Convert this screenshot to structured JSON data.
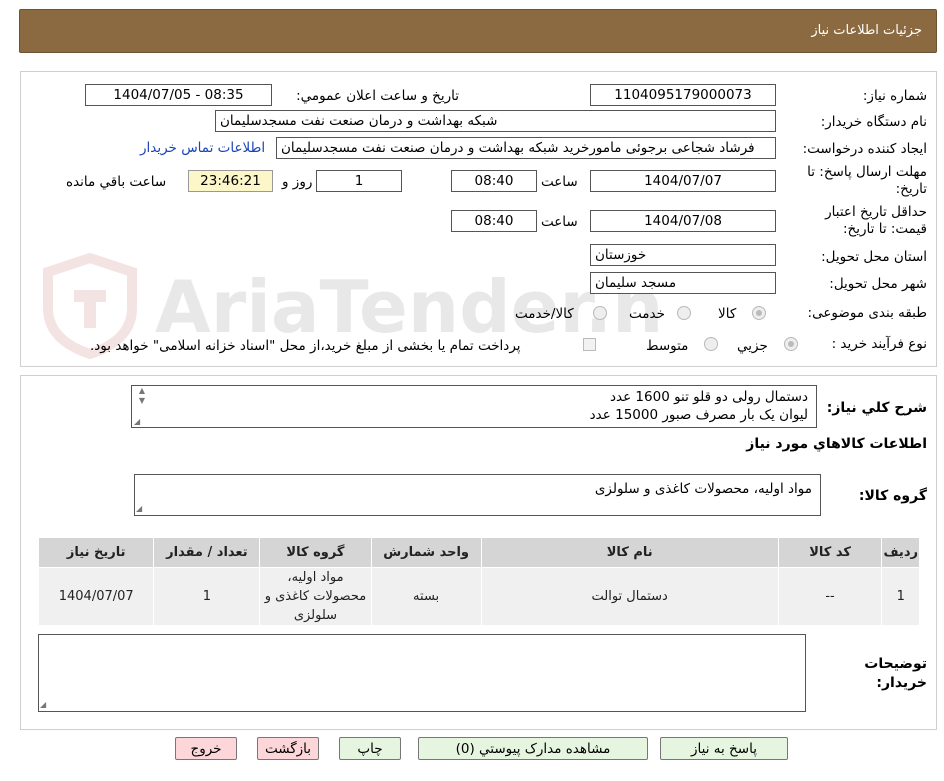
{
  "header": {
    "title": "جزئیات اطلاعات نیاز"
  },
  "watermark": {
    "text": "AriaTender.neT"
  },
  "form": {
    "need_number_label": "شماره نیاز:",
    "need_number": "1104095179000073",
    "announce_label": "تاریخ و ساعت اعلان عمومي:",
    "announce_value": "1404/07/05 - 08:35",
    "buyer_org_label": "نام دستگاه خریدار:",
    "buyer_org": "شبکه بهداشت و درمان صنعت نفت مسجدسلیمان",
    "requester_label": "ایجاد کننده درخواست:",
    "requester": "فرشاد شجاعی برجوئی مامورخرید شبکه بهداشت و درمان صنعت نفت مسجدسلیمان",
    "contact_link": "اطلاعات تماس خریدار",
    "deadline_label": "مهلت ارسال پاسخ: تا تاریخ:",
    "deadline_date": "1404/07/07",
    "time_label": "ساعت",
    "deadline_time": "08:40",
    "days_value": "1",
    "days_label": "روز و",
    "remaining_time": "23:46:21",
    "remaining_label": "ساعت باقي مانده",
    "validity_label": "حداقل تاریخ اعتبار قیمت: تا تاریخ:",
    "validity_date": "1404/07/08",
    "validity_time": "08:40",
    "province_label": "استان محل تحویل:",
    "province": "خوزستان",
    "city_label": "شهر محل تحویل:",
    "city": "مسجد سلیمان",
    "category_label": "طبقه بندی موضوعی:",
    "category_options": [
      "کالا",
      "خدمت",
      "کالا/خدمت"
    ],
    "category_selected": "کالا",
    "process_label": "نوع فرآیند خرید :",
    "process_options": [
      "جزیي",
      "متوسط"
    ],
    "process_selected": "جزیي",
    "payment_note": "پرداخت تمام یا بخشی از مبلغ خرید،از محل \"اسناد خزانه اسلامی\" خواهد بود."
  },
  "details": {
    "summary_label": "شرح كلي نياز:",
    "summary_lines": [
      "دستمال رولی دو قلو تنو 1600 عدد",
      "لیوان یک بار مصرف صبور 15000 عدد"
    ],
    "goods_info_title": "اطلاعات كالاهاي مورد نياز",
    "goods_group_label": "گروه كالا:",
    "goods_group_value": "مواد اولیه، محصولات کاغذی و سلولزی",
    "table": {
      "headers": [
        "ردیف",
        "کد کالا",
        "نام کالا",
        "واحد شمارش",
        "گروه کالا",
        "تعداد / مقدار",
        "تاریخ نیاز"
      ],
      "rows": [
        [
          "1",
          "--",
          "دستمال توالت",
          "بسته",
          "مواد اولیه، محصولات کاغذی و سلولزی",
          "1",
          "1404/07/07"
        ]
      ]
    },
    "buyer_notes_label": "توضیحات خریدار:",
    "buyer_notes_value": ""
  },
  "buttons": {
    "reply": "پاسخ به نیاز",
    "attachments": "مشاهده مدارک پیوستي (0)",
    "print": "چاپ",
    "back": "بازگشت",
    "exit": "خروج"
  },
  "colors": {
    "header_bg": "#8b6a42",
    "button_green": "#e6f5df",
    "button_red": "#fcd6d9",
    "remaining_bg": "#fdf6c8",
    "link": "#1a44b8"
  }
}
